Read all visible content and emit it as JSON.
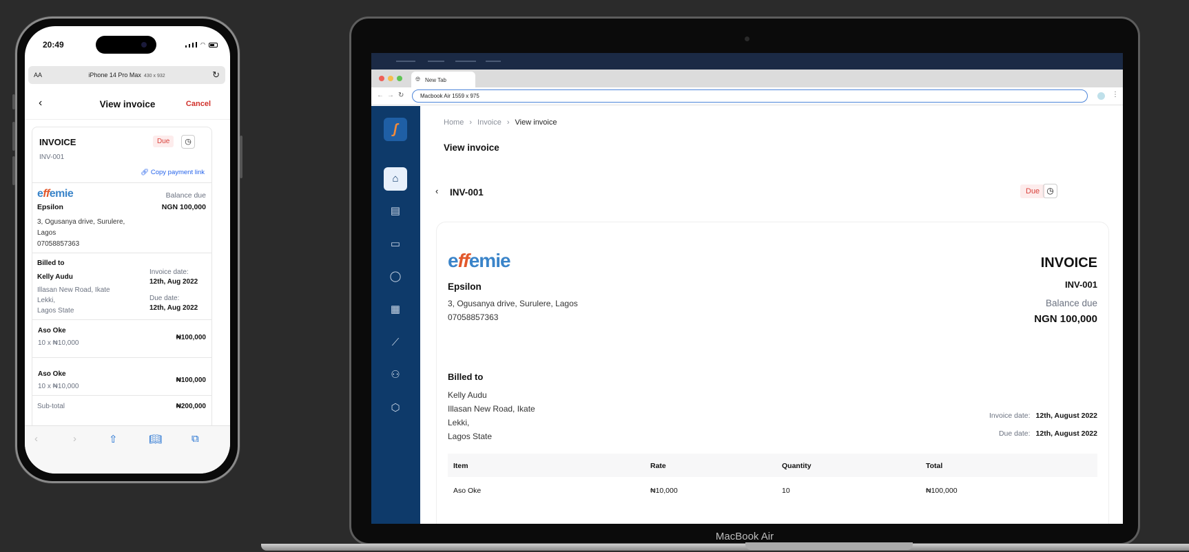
{
  "phone": {
    "status": {
      "time": "20:49"
    },
    "url": {
      "aa": "AA",
      "host": "iPhone 14 Pro Max",
      "dim": "430 x 932"
    },
    "nav": {
      "title": "View invoice",
      "cancel": "Cancel"
    },
    "invoice": {
      "heading": "INVOICE",
      "status": "Due",
      "number": "INV-001",
      "copy_link": "Copy payment link",
      "logo": {
        "prefix": "e",
        "mark": "ff",
        "suffix": "emie"
      },
      "balance_label": "Balance due",
      "company": "Epsilon",
      "balance": "NGN 100,000",
      "address": [
        "3, Ogusanya drive, Surulere,",
        "Lagos",
        "07058857363"
      ],
      "billed_to_label": "Billed to",
      "client": "Kelly Audu",
      "client_address": [
        "Illasan New Road, Ikate",
        "Lekki,",
        "Lagos State"
      ],
      "invoice_date_label": "Invoice date:",
      "invoice_date": "12th, Aug 2022",
      "due_date_label": "Due date:",
      "due_date": "12th, Aug 2022",
      "items": [
        {
          "name": "Aso Oke",
          "qty": "10 x ₦10,000",
          "total": "₦100,000"
        },
        {
          "name": "Aso Oke",
          "qty": "10 x ₦10,000",
          "total": "₦100,000"
        }
      ],
      "subtotal_label": "Sub-total",
      "subtotal": "₦200,000"
    }
  },
  "laptop": {
    "label": "MacBook Air",
    "browser": {
      "tab": "New Tab",
      "address": "Macbook Air  1559 x 975"
    },
    "breadcrumb": [
      "Home",
      "Invoice",
      "View invoice"
    ],
    "page_title": "View invoice",
    "invoice_id": "INV-001",
    "status": "Due",
    "card": {
      "logo": {
        "prefix": "e",
        "mark": "ff",
        "suffix": "emie"
      },
      "company": "Epsilon",
      "address": "3, Ogusanya drive, Surulere, Lagos",
      "phone": "07058857363",
      "heading": "INVOICE",
      "number": "INV-001",
      "balance_label": "Balance due",
      "balance": "NGN 100,000",
      "billed_to_label": "Billed to",
      "client": "Kelly Audu",
      "client_address": [
        "Illasan New Road, Ikate",
        "Lekki,",
        "Lagos State"
      ],
      "invoice_date_label": "Invoice date:",
      "invoice_date": "12th, August 2022",
      "due_date_label": "Due date:",
      "due_date": "12th, August 2022",
      "table": {
        "headers": [
          "Item",
          "Rate",
          "Quantity",
          "Total"
        ],
        "rows": [
          [
            "Aso Oke",
            "₦10,000",
            "10",
            "₦100,000"
          ]
        ]
      }
    }
  }
}
